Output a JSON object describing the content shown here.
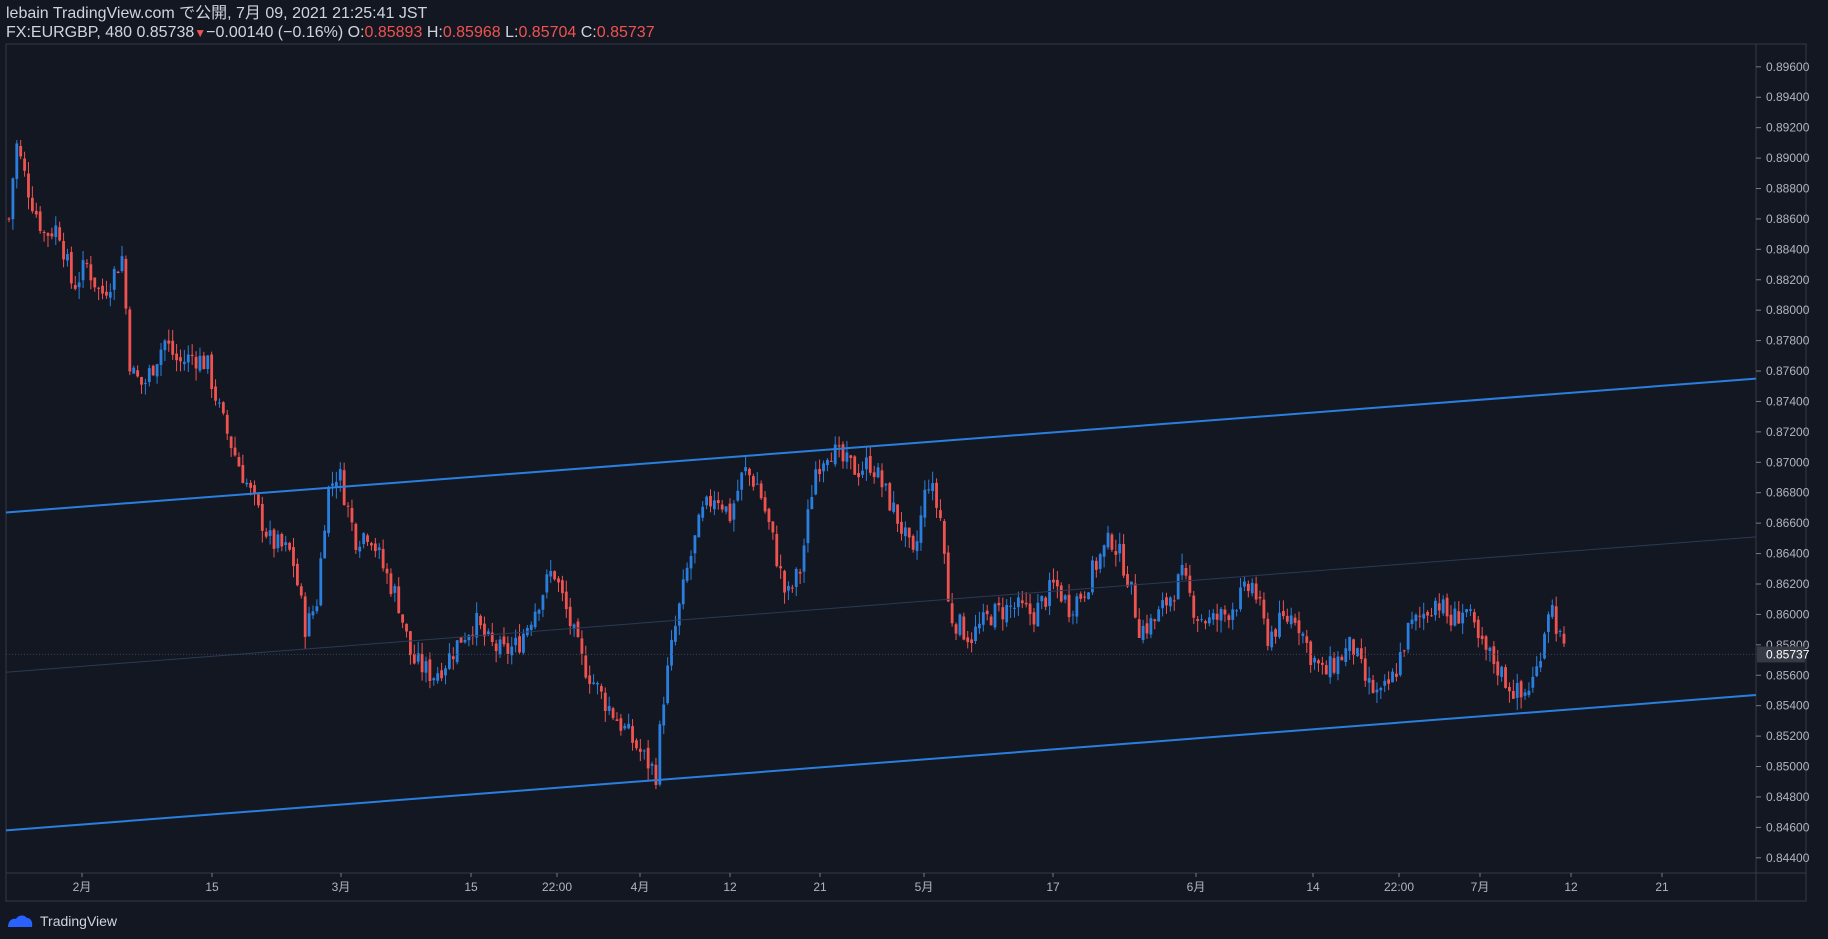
{
  "header": {
    "line1": "lebain TradingView.com で公開, 7月 09, 2021 21:25:41 JST",
    "symbol": "FX:EURGBP, 480",
    "price": "0.85738",
    "change": "−0.00140 (−0.16%)",
    "o_label": "O:",
    "o_val": "0.85893",
    "h_label": "H:",
    "h_val": "0.85968",
    "l_label": "L:",
    "l_val": "0.85704",
    "c_label": "C:",
    "c_val": "0.85737"
  },
  "footer": {
    "brand": "TradingView"
  },
  "colors": {
    "background": "#131722",
    "up": "#2a7fde",
    "down": "#ef5350",
    "channel": "#2a7fde",
    "axis_text": "#b2b5be",
    "current_label_bg": "#363a45"
  },
  "chart_data": {
    "type": "candlestick",
    "symbol": "FX:EURGBP",
    "interval": "480",
    "ylim": [
      0.843,
      0.8975
    ],
    "y_ticks": [
      "0.89600",
      "0.89400",
      "0.89200",
      "0.89000",
      "0.88800",
      "0.88600",
      "0.88400",
      "0.88200",
      "0.88000",
      "0.87800",
      "0.87600",
      "0.87400",
      "0.87200",
      "0.87000",
      "0.86800",
      "0.86600",
      "0.86400",
      "0.86200",
      "0.86000",
      "0.85800",
      "0.85600",
      "0.85400",
      "0.85200",
      "0.85000",
      "0.84800",
      "0.84600",
      "0.84400"
    ],
    "x_ticks": [
      "2月",
      "15",
      "3月",
      "15",
      "22:00",
      "4月",
      "12",
      "21",
      "5月",
      "17",
      "6月",
      "14",
      "22:00",
      "7月",
      "12",
      "21"
    ],
    "current_price": "0.85737",
    "channel": {
      "upper": [
        [
          0,
          0.8667
        ],
        [
          1,
          0.8755
        ]
      ],
      "lower": [
        [
          0,
          0.8458
        ],
        [
          1,
          0.8547
        ]
      ],
      "mid": [
        [
          0,
          0.8562
        ],
        [
          1,
          0.8651
        ]
      ]
    },
    "close_path": [
      [
        0.0,
        0.886
      ],
      [
        0.005,
        0.891
      ],
      [
        0.015,
        0.8875
      ],
      [
        0.025,
        0.885
      ],
      [
        0.035,
        0.8855
      ],
      [
        0.045,
        0.8815
      ],
      [
        0.055,
        0.883
      ],
      [
        0.065,
        0.881
      ],
      [
        0.072,
        0.882
      ],
      [
        0.08,
        0.8835
      ],
      [
        0.086,
        0.876
      ],
      [
        0.095,
        0.875
      ],
      [
        0.11,
        0.878
      ],
      [
        0.12,
        0.8765
      ],
      [
        0.13,
        0.877
      ],
      [
        0.14,
        0.8765
      ],
      [
        0.15,
        0.873
      ],
      [
        0.16,
        0.8705
      ],
      [
        0.175,
        0.867
      ],
      [
        0.185,
        0.8648
      ],
      [
        0.2,
        0.864
      ],
      [
        0.21,
        0.859
      ],
      [
        0.218,
        0.861
      ],
      [
        0.225,
        0.868
      ],
      [
        0.233,
        0.8695
      ],
      [
        0.245,
        0.865
      ],
      [
        0.255,
        0.8655
      ],
      [
        0.265,
        0.863
      ],
      [
        0.275,
        0.861
      ],
      [
        0.285,
        0.857
      ],
      [
        0.3,
        0.856
      ],
      [
        0.31,
        0.857
      ],
      [
        0.32,
        0.8585
      ],
      [
        0.33,
        0.8595
      ],
      [
        0.34,
        0.858
      ],
      [
        0.35,
        0.8575
      ],
      [
        0.36,
        0.858
      ],
      [
        0.37,
        0.86
      ],
      [
        0.385,
        0.863
      ],
      [
        0.395,
        0.86
      ],
      [
        0.405,
        0.857
      ],
      [
        0.42,
        0.8545
      ],
      [
        0.435,
        0.8525
      ],
      [
        0.45,
        0.8505
      ],
      [
        0.458,
        0.8495
      ],
      [
        0.462,
        0.854
      ],
      [
        0.47,
        0.8585
      ],
      [
        0.48,
        0.863
      ],
      [
        0.49,
        0.8665
      ],
      [
        0.5,
        0.868
      ],
      [
        0.51,
        0.8665
      ],
      [
        0.52,
        0.8695
      ],
      [
        0.53,
        0.8685
      ],
      [
        0.54,
        0.865
      ],
      [
        0.55,
        0.861
      ],
      [
        0.56,
        0.863
      ],
      [
        0.57,
        0.8695
      ],
      [
        0.58,
        0.871
      ],
      [
        0.59,
        0.87
      ],
      [
        0.6,
        0.8695
      ],
      [
        0.61,
        0.87
      ],
      [
        0.62,
        0.868
      ],
      [
        0.63,
        0.866
      ],
      [
        0.64,
        0.8635
      ],
      [
        0.65,
        0.869
      ],
      [
        0.66,
        0.866
      ],
      [
        0.665,
        0.86
      ],
      [
        0.68,
        0.8585
      ],
      [
        0.695,
        0.86
      ],
      [
        0.71,
        0.8605
      ],
      [
        0.725,
        0.86
      ],
      [
        0.74,
        0.862
      ],
      [
        0.75,
        0.8605
      ],
      [
        0.76,
        0.8615
      ],
      [
        0.77,
        0.8635
      ],
      [
        0.78,
        0.865
      ],
      [
        0.79,
        0.863
      ],
      [
        0.8,
        0.859
      ],
      [
        0.81,
        0.8595
      ],
      [
        0.82,
        0.861
      ],
      [
        0.83,
        0.8625
      ],
      [
        0.84,
        0.86
      ],
      [
        0.85,
        0.8595
      ],
      [
        0.86,
        0.86
      ],
      [
        0.87,
        0.861
      ],
      [
        0.88,
        0.862
      ],
      [
        0.89,
        0.8585
      ],
      [
        0.9,
        0.8595
      ],
      [
        0.91,
        0.86
      ],
      [
        0.92,
        0.8575
      ],
      [
        0.93,
        0.856
      ],
      [
        0.94,
        0.857
      ],
      [
        0.95,
        0.858
      ],
      [
        0.96,
        0.8555
      ],
      [
        0.97,
        0.8545
      ],
      [
        0.98,
        0.856
      ],
      [
        0.99,
        0.859
      ],
      [
        1.0,
        0.86
      ],
      [
        1.01,
        0.861
      ],
      [
        1.02,
        0.8595
      ],
      [
        1.03,
        0.8605
      ],
      [
        1.04,
        0.858
      ],
      [
        1.05,
        0.857
      ],
      [
        1.06,
        0.8555
      ],
      [
        1.07,
        0.8545
      ],
      [
        1.08,
        0.856
      ],
      [
        1.09,
        0.861
      ],
      [
        1.1,
        0.8574
      ]
    ]
  }
}
